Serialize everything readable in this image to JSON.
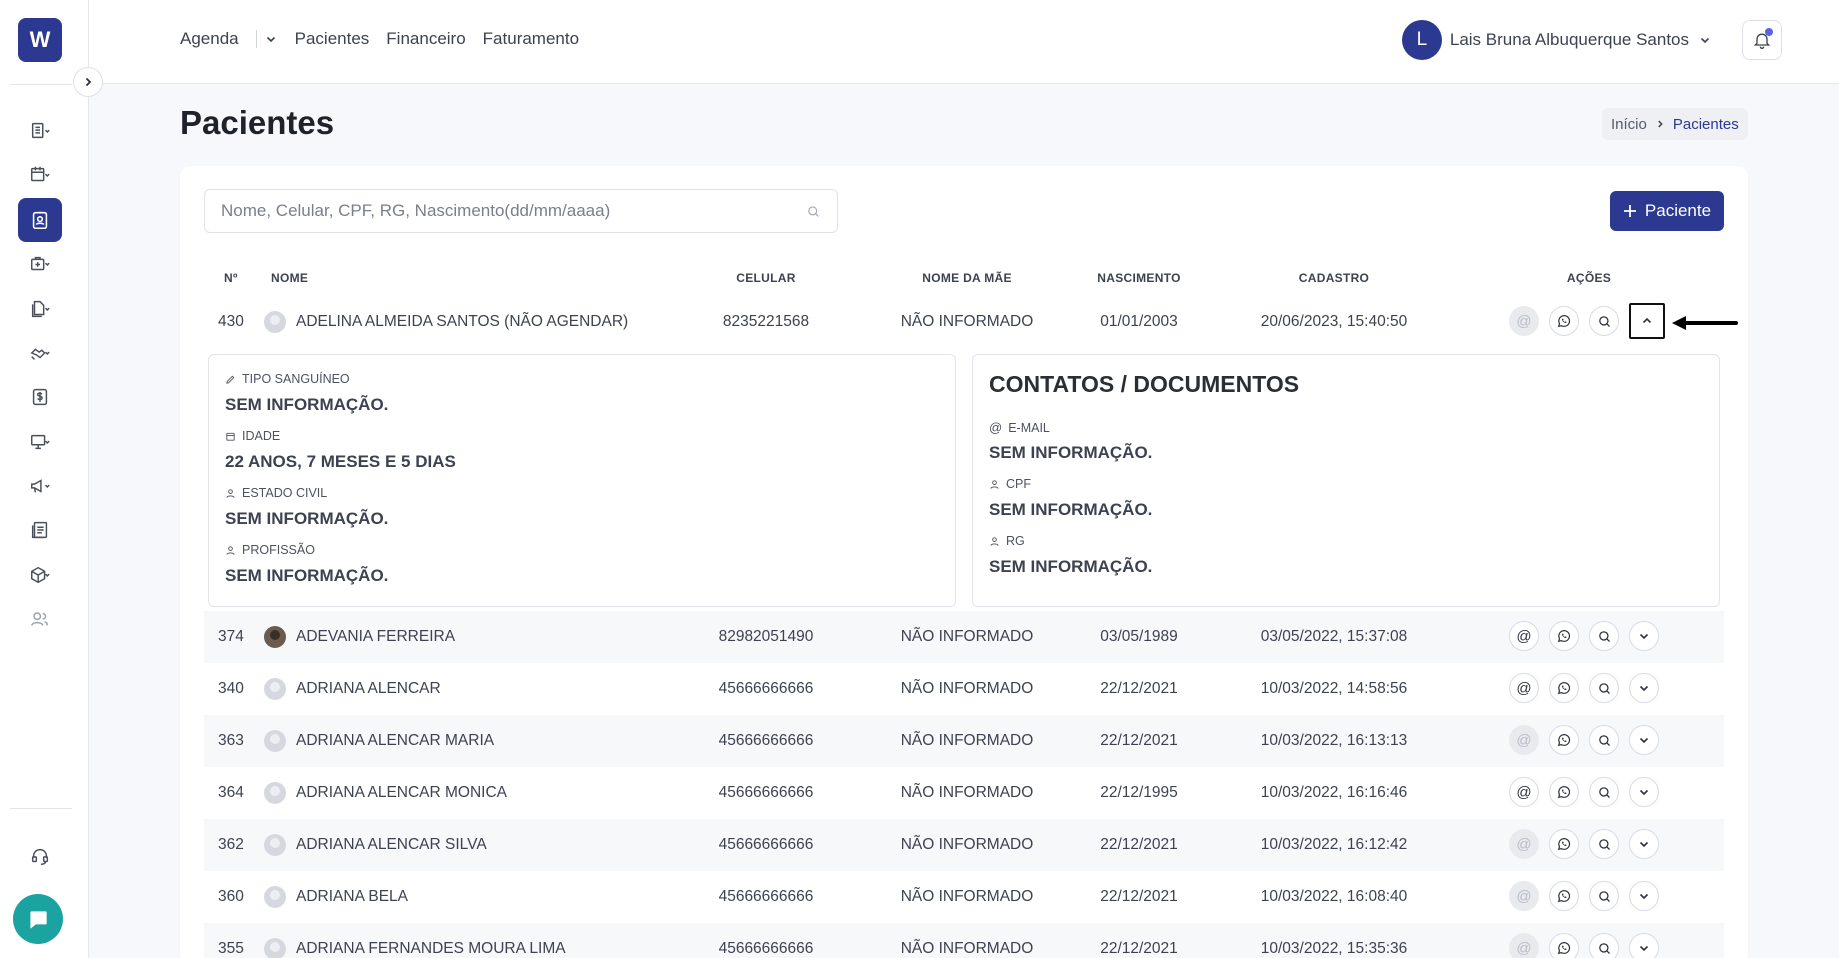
{
  "sidebar": {
    "logo_letter": "W",
    "items": [
      {
        "icon": "list-icon"
      },
      {
        "icon": "calendar-icon"
      },
      {
        "icon": "patient-card-icon",
        "active": true
      },
      {
        "icon": "medical-bag-icon"
      },
      {
        "icon": "documents-icon"
      },
      {
        "icon": "handshake-icon"
      },
      {
        "icon": "dollar-icon"
      },
      {
        "icon": "monitor-icon"
      },
      {
        "icon": "megaphone-icon"
      },
      {
        "icon": "report-icon"
      },
      {
        "icon": "box-icon"
      },
      {
        "icon": "users-icon"
      }
    ],
    "support_icon": "headset-icon",
    "chat_icon": "chat-icon"
  },
  "topbar": {
    "nav": [
      "Agenda",
      "Pacientes",
      "Financeiro",
      "Faturamento"
    ],
    "user_initial": "L",
    "user_name": "Lais Bruna Albuquerque Santos"
  },
  "page": {
    "title": "Pacientes",
    "breadcrumb_home": "Início",
    "breadcrumb_current": "Pacientes"
  },
  "search": {
    "placeholder": "Nome, Celular, CPF, RG, Nascimento(dd/mm/aaaa)"
  },
  "add_button": "Paciente",
  "table": {
    "headers": [
      "Nº",
      "NOME",
      "CELULAR",
      "NOME DA MÃE",
      "NASCIMENTO",
      "CADASTRO",
      "AÇÕES"
    ],
    "rows": [
      {
        "num": "430",
        "name": "ADELINA ALMEIDA SANTOS (NÃO AGENDAR)",
        "cel": "8235221568",
        "mae": "NÃO INFORMADO",
        "nasc": "01/01/2003",
        "cad": "20/06/2023, 15:40:50",
        "email_enabled": false,
        "expanded": true
      },
      {
        "num": "374",
        "name": "ADEVANIA FERREIRA",
        "cel": "82982051490",
        "mae": "NÃO INFORMADO",
        "nasc": "03/05/1989",
        "cad": "03/05/2022, 15:37:08",
        "email_enabled": true,
        "photo": true
      },
      {
        "num": "340",
        "name": "ADRIANA ALENCAR",
        "cel": "45666666666",
        "mae": "NÃO INFORMADO",
        "nasc": "22/12/2021",
        "cad": "10/03/2022, 14:58:56",
        "email_enabled": true
      },
      {
        "num": "363",
        "name": "ADRIANA ALENCAR MARIA",
        "cel": "45666666666",
        "mae": "NÃO INFORMADO",
        "nasc": "22/12/2021",
        "cad": "10/03/2022, 16:13:13",
        "email_enabled": false
      },
      {
        "num": "364",
        "name": "ADRIANA ALENCAR MONICA",
        "cel": "45666666666",
        "mae": "NÃO INFORMADO",
        "nasc": "22/12/1995",
        "cad": "10/03/2022, 16:16:46",
        "email_enabled": true
      },
      {
        "num": "362",
        "name": "ADRIANA ALENCAR SILVA",
        "cel": "45666666666",
        "mae": "NÃO INFORMADO",
        "nasc": "22/12/2021",
        "cad": "10/03/2022, 16:12:42",
        "email_enabled": false
      },
      {
        "num": "360",
        "name": "ADRIANA BELA",
        "cel": "45666666666",
        "mae": "NÃO INFORMADO",
        "nasc": "22/12/2021",
        "cad": "10/03/2022, 16:08:40",
        "email_enabled": false
      },
      {
        "num": "355",
        "name": "ADRIANA FERNANDES MOURA LIMA",
        "cel": "45666666666",
        "mae": "NÃO INFORMADO",
        "nasc": "22/12/2021",
        "cad": "10/03/2022, 15:35:36",
        "email_enabled": false
      }
    ]
  },
  "details": {
    "left": [
      {
        "label": "TIPO SANGUÍNEO",
        "value": "SEM INFORMAÇÃO.",
        "icon": "pencil-icon"
      },
      {
        "label": "IDADE",
        "value": "22 ANOS, 7 MESES E 5 DIAS",
        "icon": "calendar-small-icon"
      },
      {
        "label": "ESTADO CIVIL",
        "value": "SEM INFORMAÇÃO.",
        "icon": "person-icon"
      },
      {
        "label": "PROFISSÃO",
        "value": "SEM INFORMAÇÃO.",
        "icon": "person-icon"
      }
    ],
    "right_title": "CONTATOS / DOCUMENTOS",
    "right": [
      {
        "label": "E-MAIL",
        "value": "SEM INFORMAÇÃO.",
        "icon": "at-icon"
      },
      {
        "label": "CPF",
        "value": "SEM INFORMAÇÃO.",
        "icon": "person-icon"
      },
      {
        "label": "RG",
        "value": "SEM INFORMAÇÃO.",
        "icon": "person-icon"
      }
    ]
  },
  "colors": {
    "brand": "#2b3990",
    "chat": "#1aa3a0"
  }
}
